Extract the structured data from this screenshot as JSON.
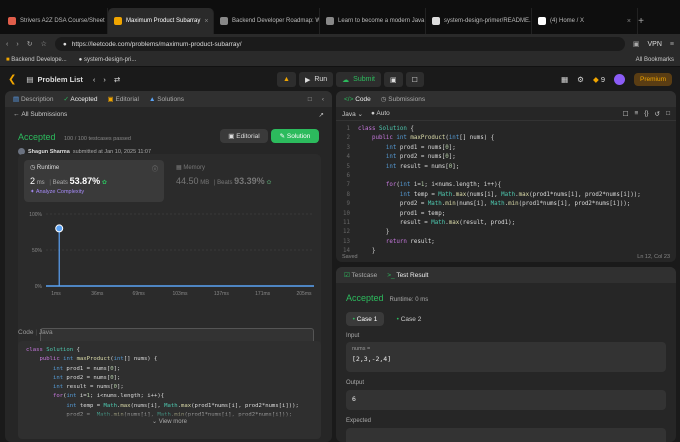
{
  "browser": {
    "tabs": [
      {
        "title": "Strivers A2Z DSA Course/Sheet",
        "color": "#e05d4a"
      },
      {
        "title": "Maximum Product Subarray",
        "color": "#f0a500",
        "active": true
      },
      {
        "title": "Backend Developer Roadmap: W",
        "color": "#888888"
      },
      {
        "title": "Learn to become a modern Java",
        "color": "#888888"
      },
      {
        "title": "system-design-primer/README.",
        "color": "#dddddd"
      },
      {
        "title": "(4) Home / X",
        "color": "#ffffff"
      }
    ],
    "url": "https://leetcode.com/problems/maximum-product-subarray/",
    "vpn": "VPN",
    "bookmarks": [
      "Backend Develope...",
      "system-design-pri..."
    ],
    "all_bookmarks": "All Bookmarks"
  },
  "header": {
    "problem_list": "Problem List",
    "run": "Run",
    "submit": "Submit",
    "fire_count": "9",
    "premium": "Premium"
  },
  "left": {
    "tabs": [
      "Description",
      "Accepted",
      "Editorial",
      "Solutions"
    ],
    "all_submissions": "All Submissions",
    "status": "Accepted",
    "passed": "100 / 100 testcases passed",
    "user": "Shagun Sharma",
    "submitted": "submitted at Jan 10, 2025 11:07",
    "editorial_btn": "Editorial",
    "solution_btn": "Solution",
    "runtime_label": "Runtime",
    "runtime_value": "2",
    "runtime_unit": "ms",
    "beats_label": "Beats",
    "runtime_beats": "53.87%",
    "analyze": "Analyze Complexity",
    "memory_label": "Memory",
    "memory_value": "44.50",
    "memory_unit": "MB",
    "memory_beats": "93.39%",
    "code_label": "Code",
    "lang": "Java",
    "view_more": "View more"
  },
  "chart_data": {
    "type": "bar",
    "x_ticks": [
      "1ms",
      "36ms",
      "69ms",
      "103ms",
      "137ms",
      "171ms",
      "205ms"
    ],
    "y_ticks": [
      "100%",
      "50%",
      "0%"
    ],
    "ylim": [
      0,
      100
    ],
    "highlight": {
      "x": "2ms",
      "value": 80
    }
  },
  "editor": {
    "tab_code": "Code",
    "tab_submissions": "Submissions",
    "lang": "Java",
    "auto": "Auto",
    "status": "Saved",
    "position": "Ln 12, Col 23"
  },
  "code_lines": [
    "class Solution {",
    "    public int maxProduct(int[] nums) {",
    "        int prod1 = nums[0];",
    "        int prod2 = nums[0];",
    "        int result = nums[0];",
    "",
    "        for(int i=1; i<nums.length; i++){",
    "            int temp = Math.max(nums[i], Math.max(prod1*nums[i], prod2*nums[i]));",
    "            prod2 = Math.min(nums[i], Math.min(prod1*nums[i], prod2*nums[i]));",
    "            prod1 = temp;",
    "            result = Math.max(result, prod1);",
    "        }",
    "        return result;",
    "    }"
  ],
  "left_code_lines": [
    "class Solution {",
    "    public int maxProduct(int[] nums) {",
    "        int prod1 = nums[0];",
    "        int prod2 = nums[0];",
    "        int result = nums[0];",
    "        for(int i=1; i<nums.length; i++){",
    "            int temp = Math.max(nums[i], Math.max(prod1*nums[i], prod2*nums[i]));",
    "            prod2 =  Math.min(nums[i], Math.min(prod1*nums[i], prod2*nums[i]));"
  ],
  "test": {
    "tab_testcase": "Testcase",
    "tab_result": "Test Result",
    "status": "Accepted",
    "runtime": "Runtime: 0 ms",
    "case1": "Case 1",
    "case2": "Case 2",
    "input_label": "Input",
    "var": "nums =",
    "input": "[2,3,-2,4]",
    "output_label": "Output",
    "output": "6",
    "expected_label": "Expected"
  }
}
